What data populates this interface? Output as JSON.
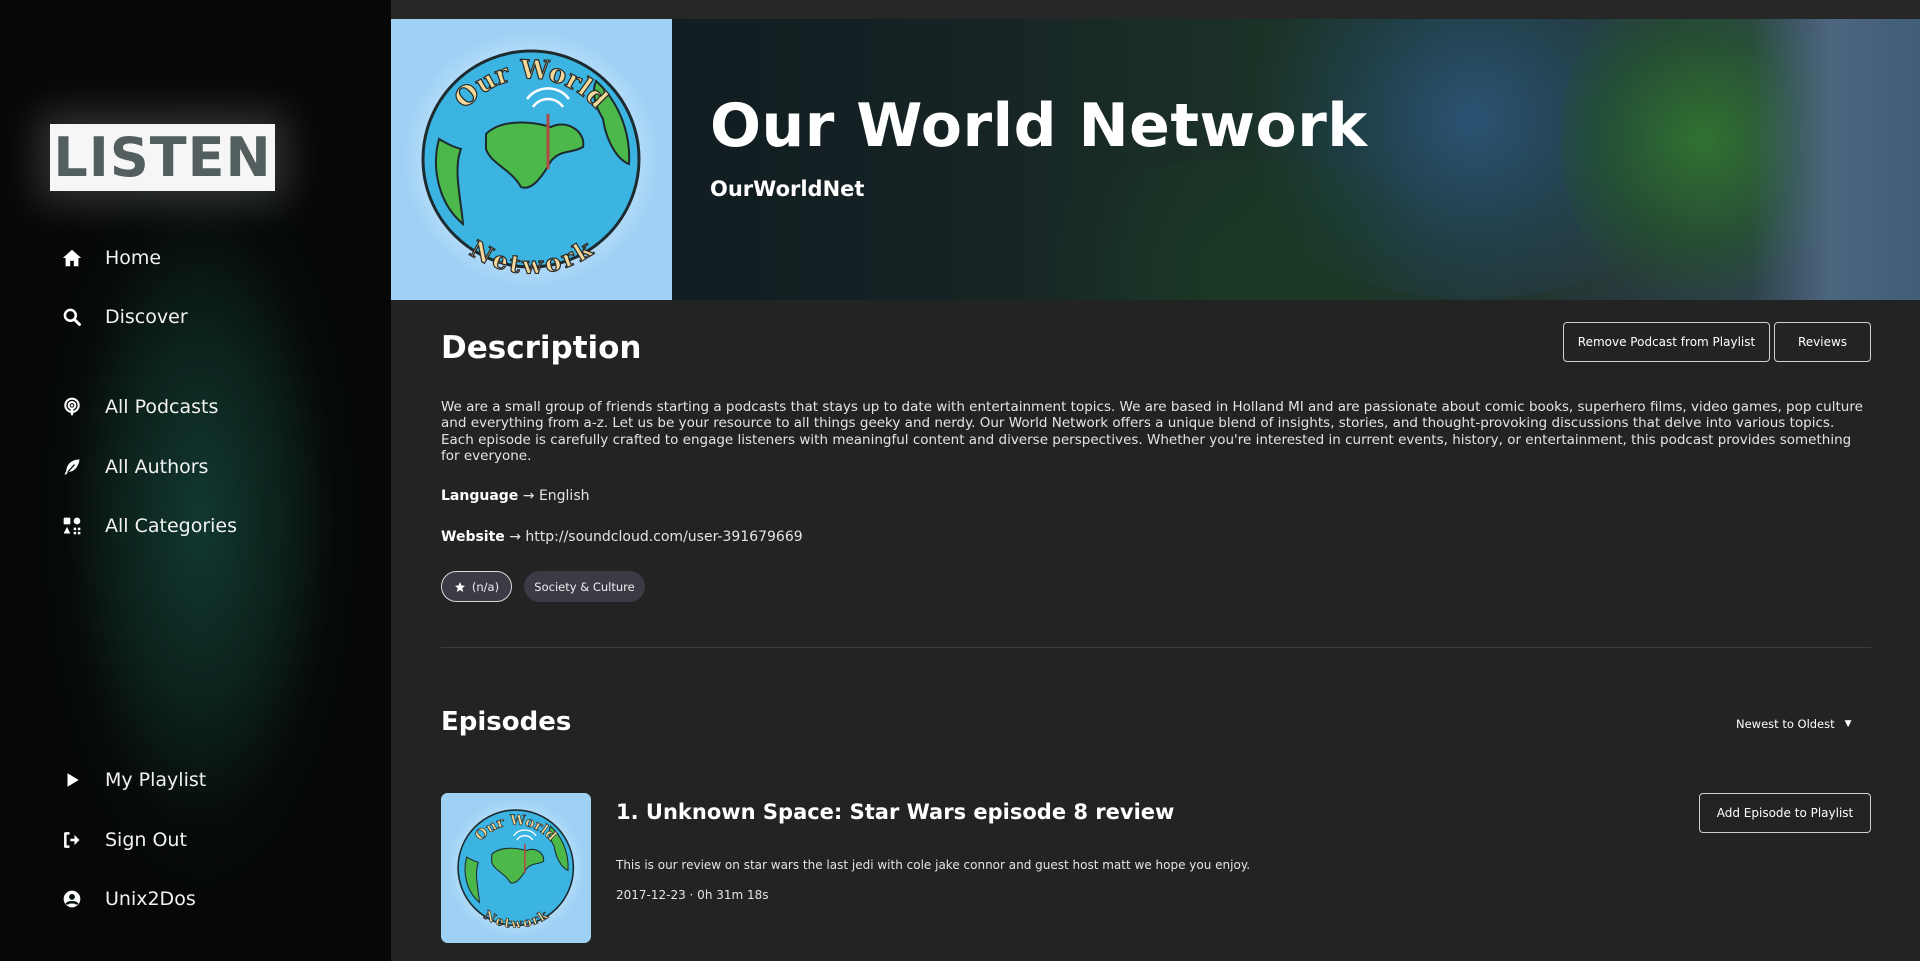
{
  "app": {
    "logo": "LISTEN"
  },
  "sidebar": {
    "items": [
      {
        "label": "Home",
        "icon": "home-icon"
      },
      {
        "label": "Discover",
        "icon": "search-icon"
      },
      {
        "label": "All Podcasts",
        "icon": "podcast-icon"
      },
      {
        "label": "All Authors",
        "icon": "feather-icon"
      },
      {
        "label": "All Categories",
        "icon": "categories-icon"
      },
      {
        "label": "My Playlist",
        "icon": "play-icon"
      },
      {
        "label": "Sign Out",
        "icon": "sign-out-icon"
      },
      {
        "label": "Unix2Dos",
        "icon": "user-circle-icon"
      }
    ]
  },
  "podcast": {
    "title": "Our World Network",
    "author": "OurWorldNet",
    "cover_text_top": "Our World",
    "cover_text_bottom": "Network"
  },
  "description": {
    "heading": "Description",
    "remove_button": "Remove Podcast from Playlist",
    "reviews_button": "Reviews",
    "text": "We are a small group of friends starting a podcasts that stays up to date with entertainment topics. We are based in Holland MI and are passionate about comic books, superhero films, video games, pop culture and everything from a-z. Let us be your resource to all things geeky and nerdy. Our World Network offers a unique blend of insights, stories, and thought-provoking discussions that delve into various topics. Each episode is carefully crafted to engage listeners with meaningful content and diverse perspectives. Whether you're interested in current events, history, or entertainment, this podcast provides something for everyone.",
    "language_label": "Language",
    "language_value": "English",
    "website_label": "Website",
    "website_value": "http://soundcloud.com/user-391679669",
    "arrow": "→",
    "rating": "(n/a)",
    "category": "Society & Culture"
  },
  "episodes": {
    "heading": "Episodes",
    "sort_label": "Newest to Oldest",
    "items": [
      {
        "title": "1. Unknown Space: Star Wars episode 8 review",
        "description": "This is our review on star wars the last jedi with cole jake connor and guest host matt we hope you enjoy.",
        "meta": "2017-12-23 · 0h 31m 18s",
        "add_button": "Add Episode to Playlist"
      }
    ]
  },
  "colors": {
    "background": "#222323",
    "sidebar": "#070a0a",
    "pill": "#3a3b45",
    "logo_text": "#535f5f"
  }
}
